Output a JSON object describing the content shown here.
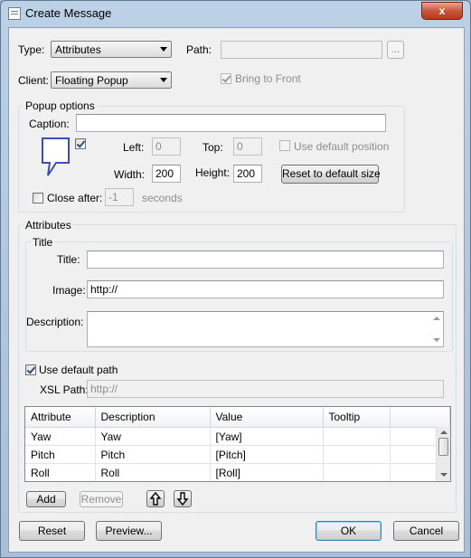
{
  "window": {
    "title": "Create Message",
    "close_glyph": "x"
  },
  "type_row": {
    "label": "Type:",
    "value": "Attributes",
    "path_label": "Path:",
    "path_value": "",
    "browse_label": "..."
  },
  "client_row": {
    "label": "Client:",
    "value": "Floating Popup",
    "bring_to_front": "Bring to Front",
    "bring_to_front_checked": true
  },
  "popup": {
    "group_label": "Popup options",
    "caption_label": "Caption:",
    "caption_value": "",
    "show_icon_checked": true,
    "left_label": "Left:",
    "left_value": "0",
    "top_label": "Top:",
    "top_value": "0",
    "use_default_position": "Use default position",
    "width_label": "Width:",
    "width_value": "200",
    "height_label": "Height:",
    "height_value": "200",
    "reset_size_label": "Reset to default size",
    "close_after_label": "Close after:",
    "close_after_checked": false,
    "close_after_value": "-1",
    "seconds_label": "seconds"
  },
  "attributes": {
    "group_label": "Attributes",
    "title_group_label": "Title",
    "title_label": "Title:",
    "title_value": "",
    "image_label": "Image:",
    "image_value": "http://",
    "description_label": "Description:",
    "description_value": "",
    "use_default_path": "Use default path",
    "use_default_path_checked": true,
    "xsl_label": "XSL Path:",
    "xsl_value": "http://",
    "table": {
      "columns": [
        "Attribute",
        "Description",
        "Value",
        "Tooltip"
      ],
      "rows": [
        [
          "Yaw",
          "Yaw",
          "[Yaw]",
          ""
        ],
        [
          "Pitch",
          "Pitch",
          "[Pitch]",
          ""
        ],
        [
          "Roll",
          "Roll",
          "[Roll]",
          ""
        ]
      ]
    },
    "add_label": "Add",
    "remove_label": "Remove",
    "move_up_icon": "arrow-up-icon",
    "move_down_icon": "arrow-down-icon"
  },
  "footer": {
    "reset": "Reset",
    "preview": "Preview...",
    "ok": "OK",
    "cancel": "Cancel"
  },
  "colors": {
    "title_bar": "#a9bfd8",
    "close_button": "#c9573c",
    "dialog_bg": "#f0f0f0"
  }
}
